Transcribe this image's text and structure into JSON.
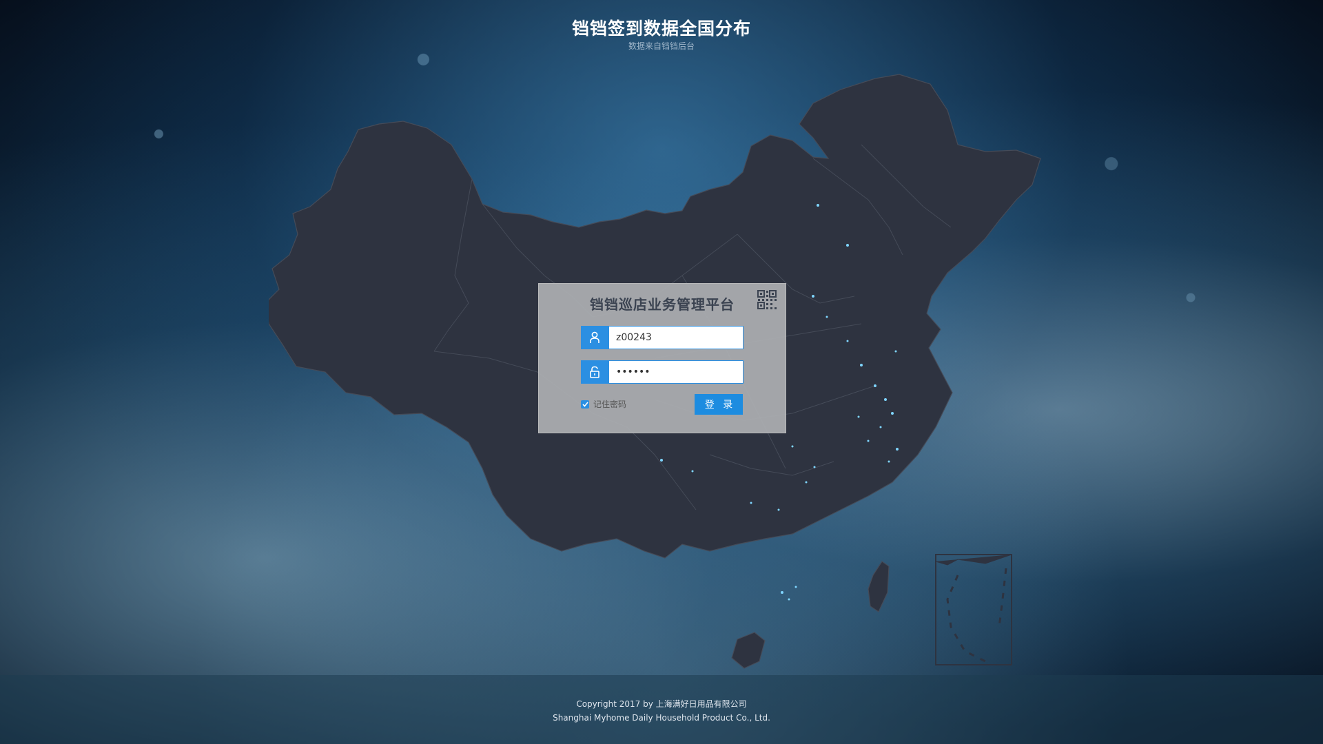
{
  "header": {
    "title": "铛铛签到数据全国分布",
    "subtitle": "数据来自铛铛后台"
  },
  "login": {
    "title": "铛铛巡店业务管理平台",
    "username_value": "z00243",
    "password_value": "••••••",
    "remember_label": "记住密码",
    "remember_checked": true,
    "login_button": "登 录",
    "icons": {
      "qr": "qr-code-icon",
      "user": "user-icon",
      "lock": "lock-icon",
      "check": "check-icon"
    }
  },
  "footer": {
    "line1": "Copyright 2017 by 上海满好日用品有限公司",
    "line2": "Shanghai Myhome Daily Household Product Co., Ltd."
  },
  "colors": {
    "accent": "#2b8fe2",
    "map_fill": "#2e3340",
    "map_stroke": "#454b58",
    "data_point": "#7fd6ff",
    "panel_bg": "#acaeb2"
  }
}
